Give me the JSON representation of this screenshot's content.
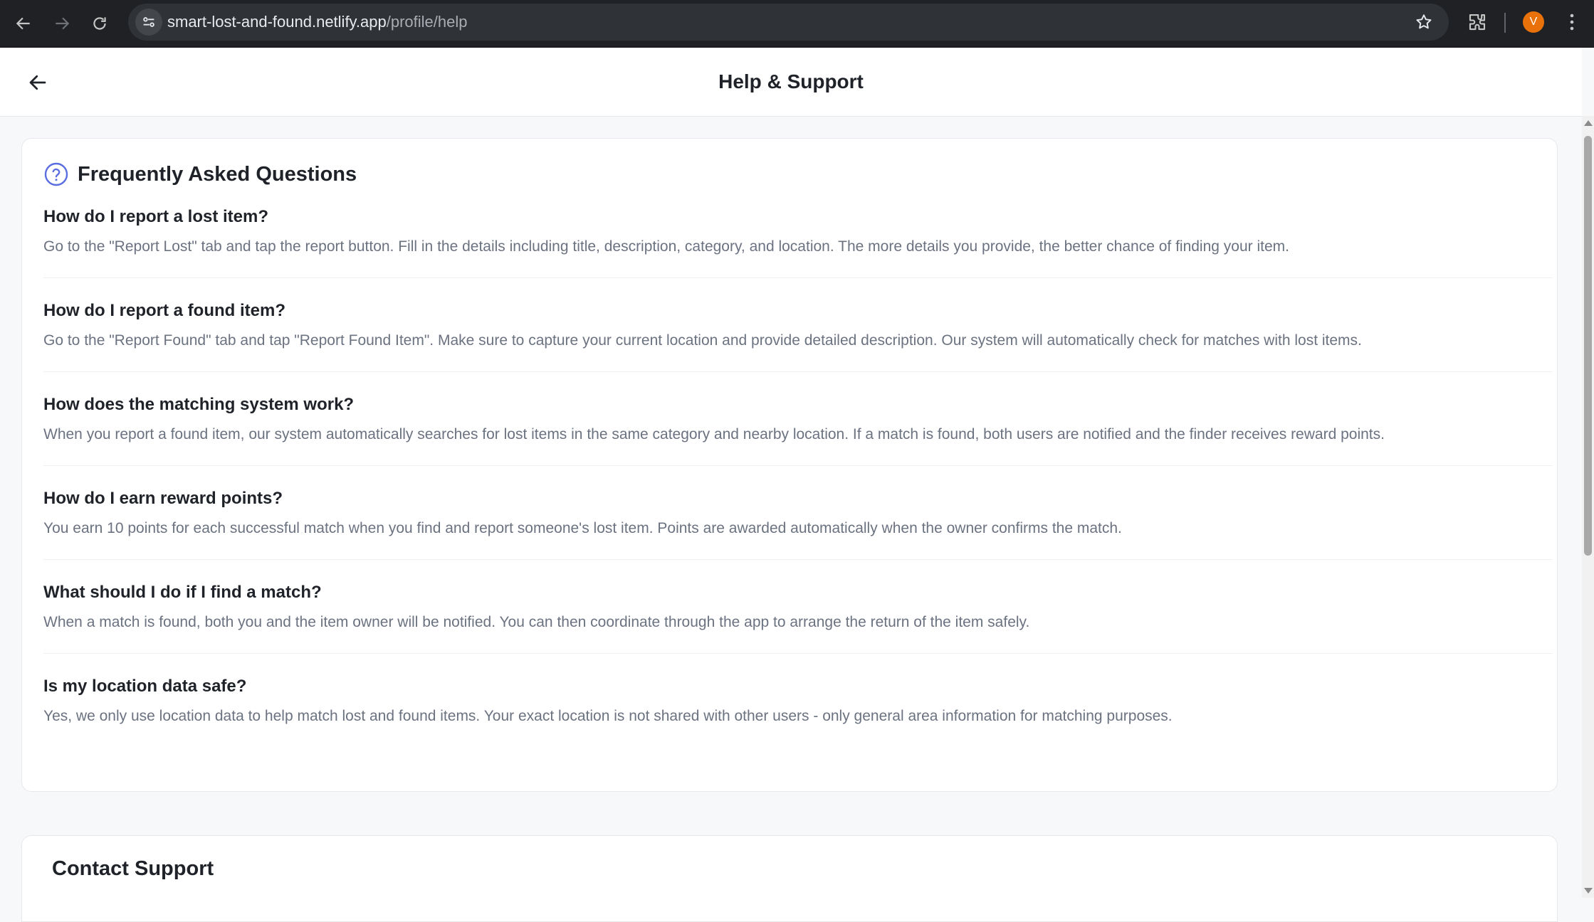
{
  "browser": {
    "url_host": "smart-lost-and-found.netlify.app",
    "url_path": "/profile/help",
    "profile_initial": "V",
    "profile_color": "#e8710a"
  },
  "header": {
    "title": "Help & Support"
  },
  "faq": {
    "heading": "Frequently Asked Questions",
    "accent_color": "#5b6ee1",
    "items": [
      {
        "question": "How do I report a lost item?",
        "answer": "Go to the \"Report Lost\" tab and tap the report button. Fill in the details including title, description, category, and location. The more details you provide, the better chance of finding your item."
      },
      {
        "question": "How do I report a found item?",
        "answer": "Go to the \"Report Found\" tab and tap \"Report Found Item\". Make sure to capture your current location and provide detailed description. Our system will automatically check for matches with lost items."
      },
      {
        "question": "How does the matching system work?",
        "answer": "When you report a found item, our system automatically searches for lost items in the same category and nearby location. If a match is found, both users are notified and the finder receives reward points."
      },
      {
        "question": "How do I earn reward points?",
        "answer": "You earn 10 points for each successful match when you find and report someone's lost item. Points are awarded automatically when the owner confirms the match."
      },
      {
        "question": "What should I do if I find a match?",
        "answer": "When a match is found, both you and the item owner will be notified. You can then coordinate through the app to arrange the return of the item safely."
      },
      {
        "question": "Is my location data safe?",
        "answer": "Yes, we only use location data to help match lost and found items. Your exact location is not shared with other users - only general area information for matching purposes."
      }
    ]
  },
  "contact": {
    "heading": "Contact Support"
  }
}
